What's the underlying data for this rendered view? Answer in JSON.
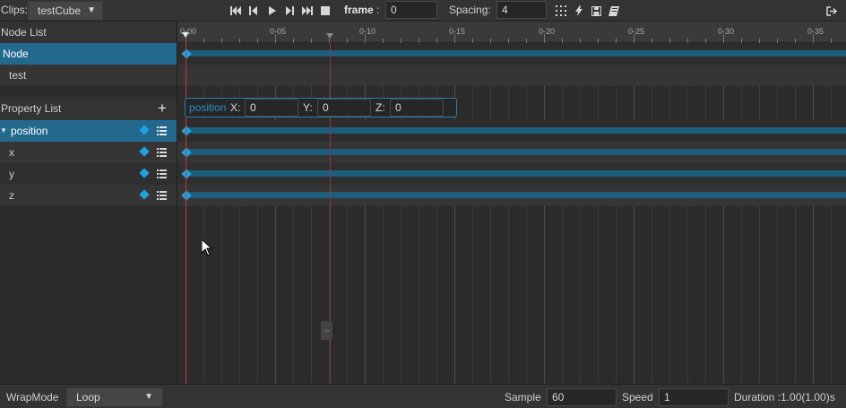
{
  "toolbar": {
    "clips_label": "Clips:",
    "clip_name": "testCube",
    "frame_label": "frame",
    "frame_colon": ":",
    "frame_value": "0",
    "spacing_label": "Spacing:",
    "spacing_value": "4"
  },
  "node_list": {
    "title": "Node List",
    "items": [
      "Node",
      "test"
    ]
  },
  "property_list": {
    "title": "Property List",
    "add_symbol": "+",
    "items": [
      {
        "label": "position"
      },
      {
        "label": "x"
      },
      {
        "label": "y"
      },
      {
        "label": "z"
      }
    ]
  },
  "position_editor": {
    "label": "position",
    "x_label": "X:",
    "x_value": "0",
    "y_label": "Y:",
    "y_value": "0",
    "z_label": "Z:",
    "z_value": "0"
  },
  "timeline": {
    "tick_labels": [
      "0-00",
      "0-05",
      "0-10",
      "0-15",
      "0-20",
      "0-25",
      "0-30",
      "0-35"
    ]
  },
  "bottom": {
    "wrapmode_label": "WrapMode",
    "wrapmode_value": "Loop",
    "sample_label": "Sample",
    "sample_value": "60",
    "speed_label": "Speed",
    "speed_value": "1",
    "duration_text": "Duration :1.00(1.00)s"
  },
  "colors": {
    "selection": "#23698d",
    "keyframe": "#1fa3e0",
    "track": "#1d5e7d",
    "playhead": "#c23b3b",
    "accent_border": "#2b7ea8"
  }
}
